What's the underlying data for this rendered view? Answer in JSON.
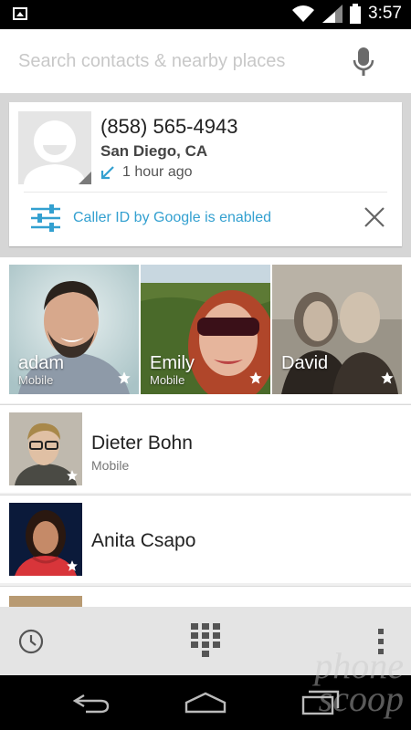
{
  "status_bar": {
    "time": "3:57"
  },
  "search": {
    "placeholder": "Search contacts & nearby places"
  },
  "recent_call": {
    "number": "(858) 565-4943",
    "location": "San Diego, CA",
    "time_ago": "1 hour ago",
    "caller_id_text": "Caller ID by Google is enabled"
  },
  "favorites": [
    {
      "name": "adam",
      "type": "Mobile"
    },
    {
      "name": "Emily",
      "type": "Mobile"
    },
    {
      "name": "David",
      "type": ""
    }
  ],
  "contacts": [
    {
      "name": "Dieter Bohn",
      "type": "Mobile"
    },
    {
      "name": "Anita Csapo",
      "type": ""
    }
  ],
  "watermark": {
    "line1": "phone",
    "line2": "scoop"
  },
  "colors": {
    "accent": "#33a0d0",
    "status_bar": "#000000",
    "bottom_bar": "#e4e4e4"
  }
}
